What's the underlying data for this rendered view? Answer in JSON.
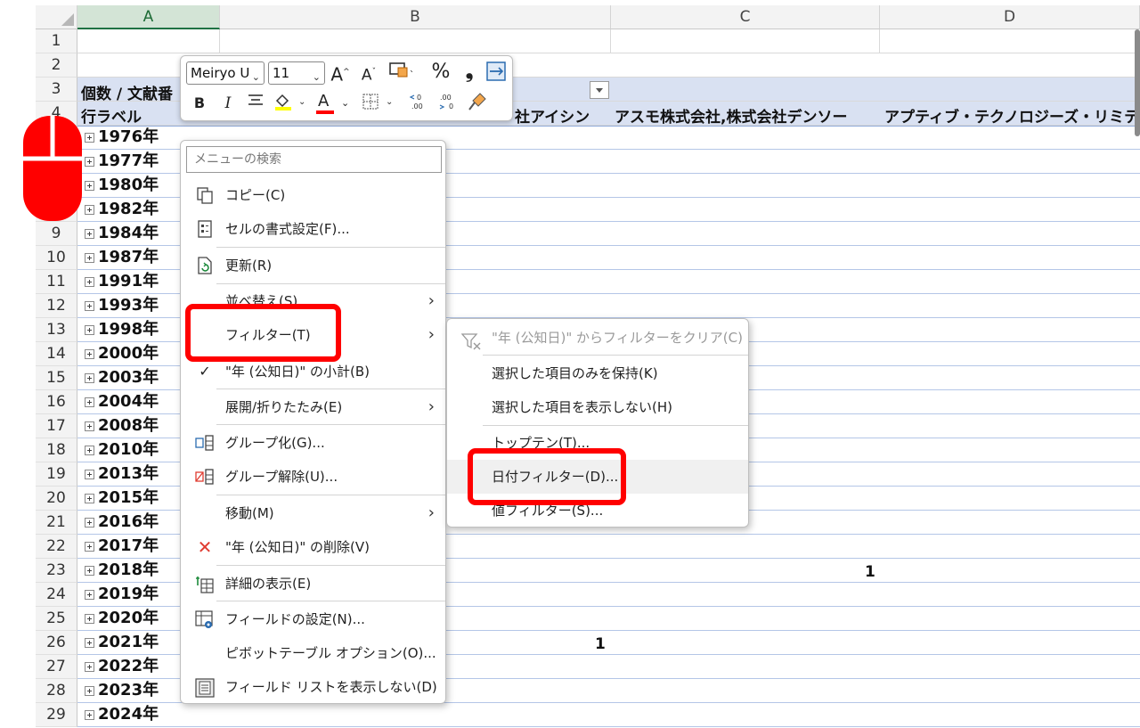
{
  "columns": [
    {
      "id": "A",
      "label": "A",
      "selected": true
    },
    {
      "id": "B",
      "label": "B"
    },
    {
      "id": "C",
      "label": "C"
    },
    {
      "id": "D",
      "label": "D"
    }
  ],
  "rows": [
    "1",
    "2",
    "3",
    "4",
    "5",
    "6",
    "7",
    "8",
    "9",
    "10",
    "11",
    "12",
    "13",
    "14",
    "15",
    "16",
    "17",
    "18",
    "19",
    "20",
    "21",
    "22",
    "23",
    "24",
    "25",
    "26",
    "27",
    "28",
    "29"
  ],
  "pivot": {
    "header_row3": "個数 / 文献番",
    "row_label": "行ラベル",
    "col_b_partial": "社アイシン",
    "col_c": "アスモ株式会社,株式会社デンソー",
    "col_d": "アプティブ・テクノロジーズ・リミテッド",
    "years": [
      "1976年",
      "1977年",
      "1980年",
      "1982年",
      "1984年",
      "1987年",
      "1991年",
      "1993年",
      "1998年",
      "2000年",
      "2003年",
      "2004年",
      "2008年",
      "2010年",
      "2013年",
      "2015年",
      "2016年",
      "2017年",
      "2018年",
      "2019年",
      "2020年",
      "2021年",
      "2022年",
      "2023年",
      "2024年"
    ],
    "values": [
      {
        "row": "23",
        "col": "D",
        "value": "1"
      },
      {
        "row": "26",
        "col": "B",
        "value": "1"
      }
    ]
  },
  "mini_toolbar": {
    "font": "Meiryo U",
    "size": "11",
    "grow": "A",
    "shrink": "A",
    "percent": "%",
    "comma": "❟",
    "bold": "B",
    "italic": "I",
    "font_color_letter": "A"
  },
  "context_menu": {
    "search_placeholder": "メニューの検索",
    "items": [
      {
        "label": "コピー(C)"
      },
      {
        "label": "セルの書式設定(F)..."
      },
      {
        "label": "更新(R)"
      },
      {
        "label": "並べ替え(S)"
      },
      {
        "label": "フィルター(T)"
      },
      {
        "label": "\"年 (公知日)\" の小計(B)"
      },
      {
        "label": "展開/折りたたみ(E)"
      },
      {
        "label": "グループ化(G)..."
      },
      {
        "label": "グループ解除(U)..."
      },
      {
        "label": "移動(M)"
      },
      {
        "label": "\"年 (公知日)\" の削除(V)"
      },
      {
        "label": "詳細の表示(E)"
      },
      {
        "label": "フィールドの設定(N)..."
      },
      {
        "label": "ピボットテーブル オプション(O)..."
      },
      {
        "label": "フィールド リストを表示しない(D)"
      }
    ]
  },
  "filter_submenu": {
    "items": [
      {
        "label": "\"年 (公知日)\" からフィルターをクリア(C)",
        "disabled": true
      },
      {
        "label": "選択した項目のみを保持(K)"
      },
      {
        "label": "選択した項目を表示しない(H)"
      },
      {
        "label": "トップテン(T)..."
      },
      {
        "label": "日付フィルター(D)..."
      },
      {
        "label": "値フィルター(S)..."
      }
    ]
  },
  "colors": {
    "accent": "#1f7244",
    "highlight": "#ff0000",
    "pivot_header": "#d9e1f2"
  }
}
